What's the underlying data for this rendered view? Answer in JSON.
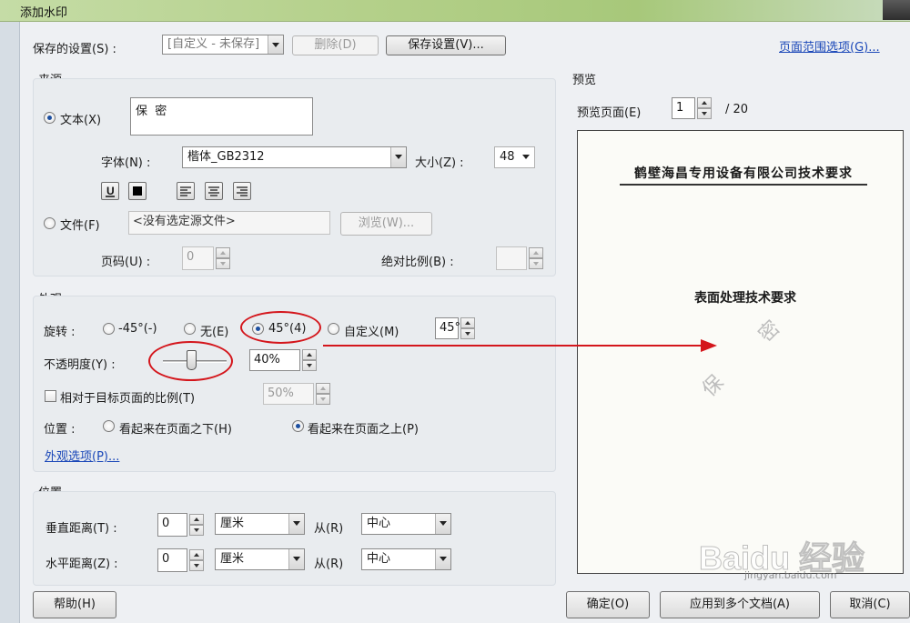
{
  "window": {
    "title": "添加水印"
  },
  "saved_settings": {
    "label": "保存的设置(S) :",
    "value": "[自定义 - 未保存]",
    "delete_label": "删除(D)",
    "save_label": "保存设置(V)..."
  },
  "page_range_link": "页面范围选项(G)...",
  "source": {
    "title": "来源",
    "text_radio": "文本(X)",
    "text_value": "保  密",
    "font_label": "字体(N) :",
    "font_value": "楷体_GB2312",
    "size_label": "大小(Z) :",
    "size_value": "48",
    "file_radio": "文件(F)",
    "file_placeholder": "<没有选定源文件>",
    "browse_label": "浏览(W)...",
    "page_label": "页码(U) :",
    "page_value": "0",
    "scale_label": "绝对比例(B) :"
  },
  "appearance": {
    "title": "外观",
    "rotation_label": "旋转 :",
    "rot_minus45": "-45°(-)",
    "rot_none": "无(E)",
    "rot_45": "45°(4)",
    "rot_custom": "自定义(M)",
    "rot_custom_value": "45°",
    "opacity_label": "不透明度(Y) :",
    "opacity_value": "40%",
    "opacity_fraction": 0.4,
    "relative_scale_label": "相对于目标页面的比例(T)",
    "relative_scale_value": "50%",
    "position_label": "位置 :",
    "pos_below": "看起来在页面之下(H)",
    "pos_above": "看起来在页面之上(P)",
    "options_link": "外观选项(P)..."
  },
  "position": {
    "title": "位置",
    "vertical_label": "垂直距离(T) :",
    "vertical_value": "0",
    "vertical_unit": "厘米",
    "vertical_from_label": "从(R)",
    "vertical_from": "中心",
    "horizontal_label": "水平距离(Z) :",
    "horizontal_value": "0",
    "horizontal_unit": "厘米",
    "horizontal_from_label": "从(R)",
    "horizontal_from": "中心"
  },
  "preview": {
    "title": "预览",
    "page_label": "预览页面(E)",
    "page_value": "1",
    "page_total": "/ 20",
    "doc_heading": "鹤壁海昌专用设备有限公司技术要求",
    "doc_subheading": "表面处理技术要求",
    "watermark_char1": "保",
    "watermark_char2": "密"
  },
  "buttons": {
    "help": "帮助(H)",
    "ok": "确定(O)",
    "apply_multiple": "应用到多个文档(A)",
    "cancel": "取消(C)"
  },
  "annotation_color": "#d4161c",
  "footer_watermark": "Baidu 经验",
  "footer_url": "jingyan.baidu.com"
}
